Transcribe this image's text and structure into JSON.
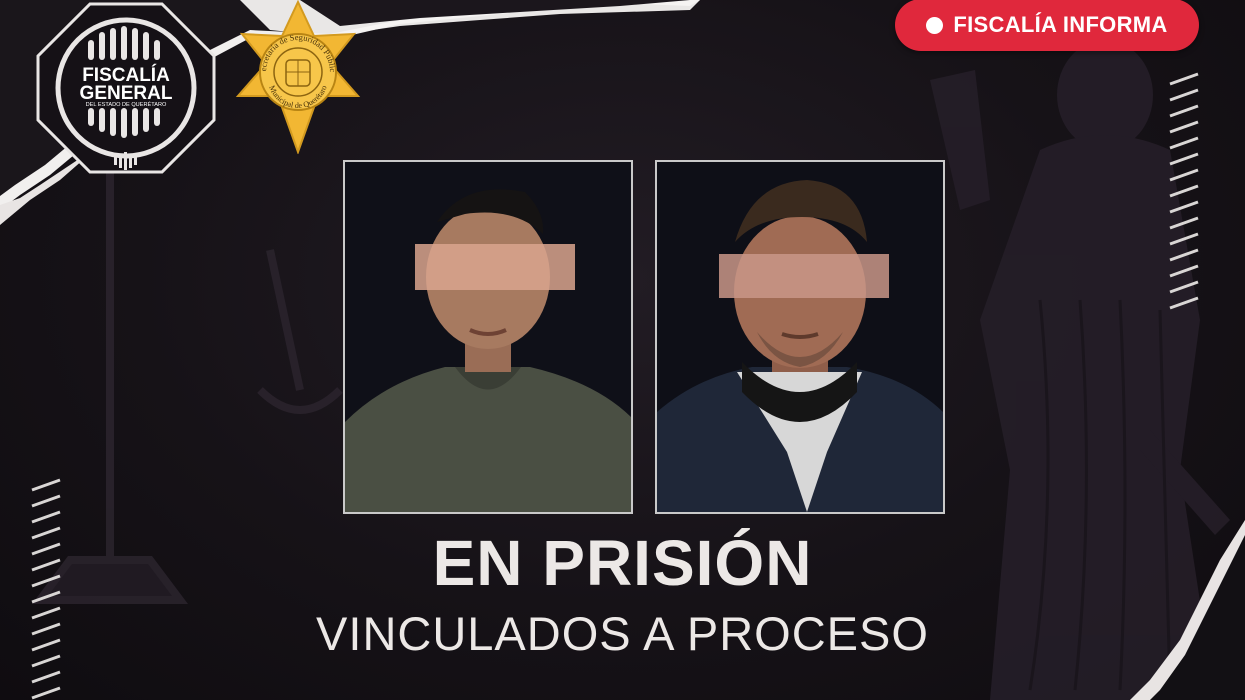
{
  "header": {
    "badge_label": "FISCALÍA INFORMA",
    "badge_color": "#e0283c"
  },
  "logos": {
    "fiscalia": {
      "line1": "FISCALÍA",
      "line2": "GENERAL",
      "line3": "DEL ESTADO DE QUERÉTARO"
    },
    "ssp": {
      "arc_top": "Secretaría de Seguridad Pública",
      "arc_bottom": "Municipal de Querétaro"
    }
  },
  "photos": [
    {
      "name": "detenido-1"
    },
    {
      "name": "detenido-2"
    }
  ],
  "main": {
    "headline": "EN PRISIÓN",
    "subheadline": "VINCULADOS A PROCESO"
  },
  "colors": {
    "background": "#161217",
    "text": "#ece8e6",
    "star_gold": "#f2b733"
  }
}
